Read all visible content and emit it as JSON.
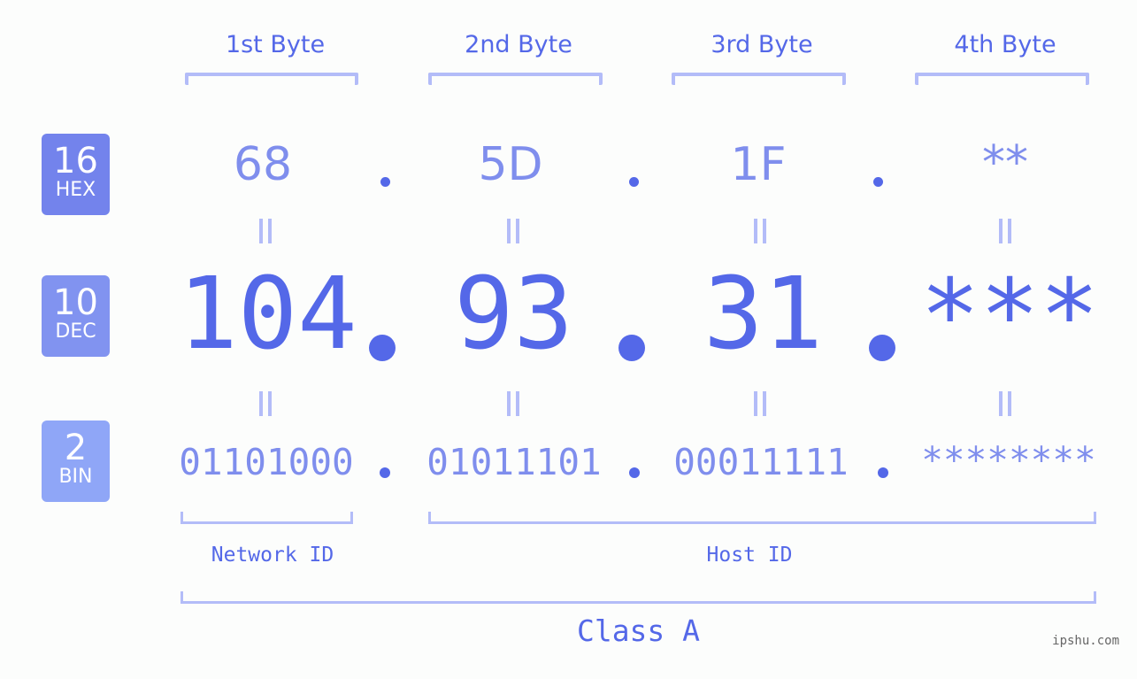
{
  "bytes": {
    "headers": [
      "1st Byte",
      "2nd Byte",
      "3rd Byte",
      "4th Byte"
    ]
  },
  "badges": {
    "hex": {
      "number": "16",
      "label": "HEX",
      "color": "#7383ec"
    },
    "dec": {
      "number": "10",
      "label": "DEC",
      "color": "#8193f0"
    },
    "bin": {
      "number": "2",
      "label": "BIN",
      "color": "#8fa6f7"
    }
  },
  "hex": [
    "68",
    "5D",
    "1F",
    "**"
  ],
  "dec": [
    "104",
    "93",
    "31",
    "***"
  ],
  "bin": [
    "01101000",
    "01011101",
    "00011111",
    "********"
  ],
  "separator": ".",
  "equals_glyph": "=",
  "segments": {
    "network_id": "Network ID",
    "host_id": "Host ID",
    "class": "Class A"
  },
  "watermark": "ipshu.com",
  "colors": {
    "primary": "#5468e8",
    "secondary": "#7f8eed",
    "bracket": "#b3bcf8",
    "background": "#fcfdfc"
  }
}
